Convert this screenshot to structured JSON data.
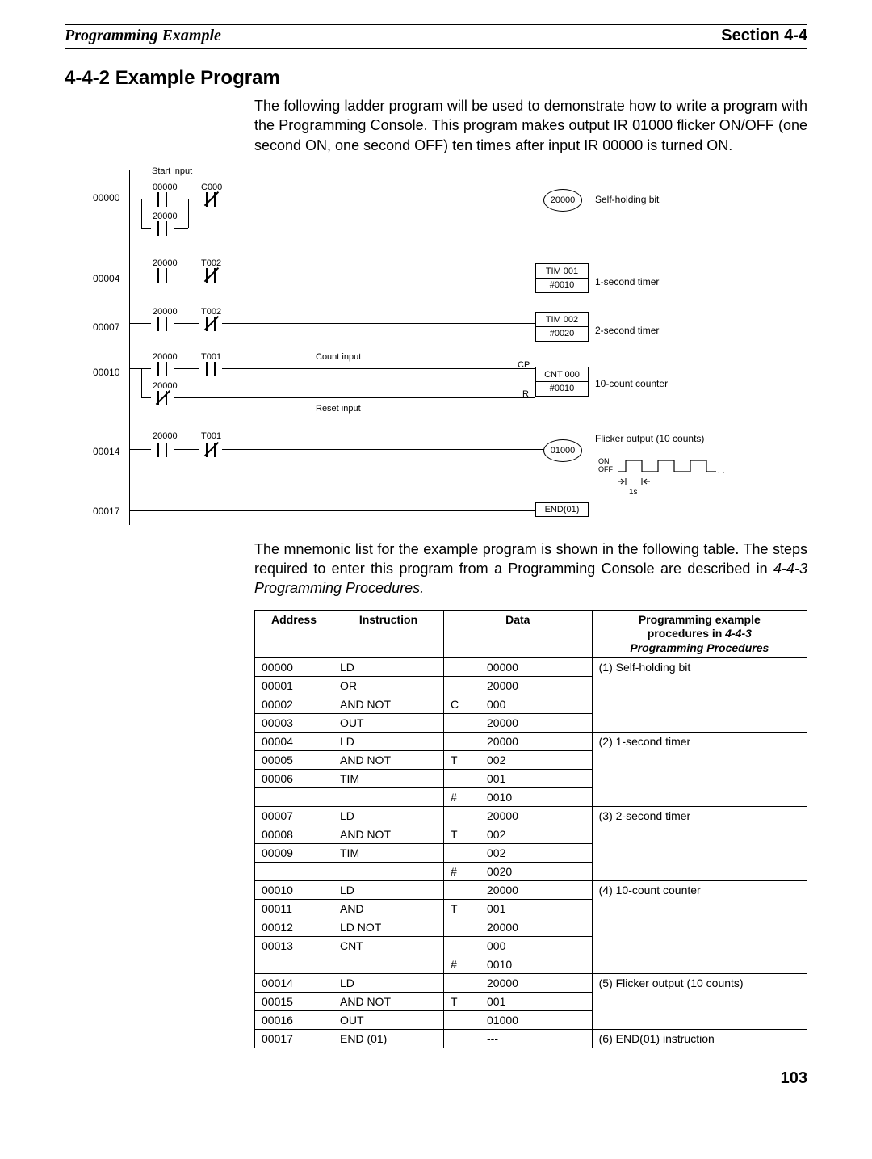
{
  "header": {
    "left": "Programming Example",
    "right": "Section 4-4"
  },
  "section_title": "4-4-2  Example Program",
  "intro": "The following ladder program will be used to demonstrate how to write a program with the Programming Console. This program makes output IR 01000 flicker ON/OFF (one second ON, one second OFF) ten times after input IR 00000 is turned ON.",
  "ladder": {
    "start_input": "Start input",
    "rungs": [
      {
        "addr": "00000",
        "c1": "00000",
        "c2": "C000",
        "or1": "20000",
        "coil": "20000",
        "ann": "Self-holding bit"
      },
      {
        "addr": "00004",
        "c1": "20000",
        "c2": "T002",
        "blk1": "TIM 001",
        "blk2": "#0010",
        "ann": "1-second timer"
      },
      {
        "addr": "00007",
        "c1": "20000",
        "c2": "T002",
        "blk1": "TIM 002",
        "blk2": "#0020",
        "ann": "2-second timer"
      },
      {
        "addr": "00010",
        "c1": "20000",
        "c2": "T001",
        "or1": "20000",
        "count_lbl": "Count input",
        "reset_lbl": "Reset input",
        "cp": "CP",
        "r": "R",
        "blk1": "CNT 000",
        "blk2": "#0010",
        "ann": "10-count counter"
      },
      {
        "addr": "00014",
        "c1": "20000",
        "c2": "T001",
        "coil": "01000",
        "ann": "Flicker output (10 counts)",
        "on": "ON",
        "off": "OFF",
        "one_s": "1s"
      },
      {
        "addr": "00017",
        "blk1": "END(01)"
      }
    ]
  },
  "mnemonic_para1": "The mnemonic list for the example program is shown in the following table. The steps required to enter this program from a Programming Console are described in ",
  "mnemonic_para_em": "4-4-3 Programming Procedures.",
  "table": {
    "headers": {
      "address": "Address",
      "instruction": "Instruction",
      "data": "Data",
      "proc1": "Programming example",
      "proc2": "procedures in ",
      "proc2em": "4-4-3",
      "proc3": "Programming Procedures"
    },
    "rows": [
      {
        "a": "00000",
        "i": "LD",
        "d1": "",
        "d2": "00000",
        "p": "(1) Self-holding bit",
        "prows": 4
      },
      {
        "a": "00001",
        "i": "OR",
        "d1": "",
        "d2": "20000"
      },
      {
        "a": "00002",
        "i": "AND NOT",
        "d1": "C",
        "d2": "000"
      },
      {
        "a": "00003",
        "i": "OUT",
        "d1": "",
        "d2": "20000"
      },
      {
        "a": "00004",
        "i": "LD",
        "d1": "",
        "d2": "20000",
        "p": "(2) 1-second timer",
        "prows": 4
      },
      {
        "a": "00005",
        "i": "AND NOT",
        "d1": "T",
        "d2": "002"
      },
      {
        "a": "00006",
        "i": "TIM",
        "d1": "",
        "d2": "001"
      },
      {
        "a": "",
        "i": "",
        "d1": "#",
        "d2": "0010"
      },
      {
        "a": "00007",
        "i": "LD",
        "d1": "",
        "d2": "20000",
        "p": "(3) 2-second timer",
        "prows": 4
      },
      {
        "a": "00008",
        "i": "AND NOT",
        "d1": "T",
        "d2": "002"
      },
      {
        "a": "00009",
        "i": "TIM",
        "d1": "",
        "d2": "002"
      },
      {
        "a": "",
        "i": "",
        "d1": "#",
        "d2": "0020"
      },
      {
        "a": "00010",
        "i": "LD",
        "d1": "",
        "d2": "20000",
        "p": "(4) 10-count counter",
        "prows": 5
      },
      {
        "a": "00011",
        "i": "AND",
        "d1": "T",
        "d2": "001"
      },
      {
        "a": "00012",
        "i": "LD NOT",
        "d1": "",
        "d2": "20000"
      },
      {
        "a": "00013",
        "i": "CNT",
        "d1": "",
        "d2": "000"
      },
      {
        "a": "",
        "i": "",
        "d1": "#",
        "d2": "0010"
      },
      {
        "a": "00014",
        "i": "LD",
        "d1": "",
        "d2": "20000",
        "p": "(5) Flicker output (10 counts)",
        "prows": 3
      },
      {
        "a": "00015",
        "i": "AND NOT",
        "d1": "T",
        "d2": "001"
      },
      {
        "a": "00016",
        "i": "OUT",
        "d1": "",
        "d2": "01000"
      },
      {
        "a": "00017",
        "i": "END (01)",
        "d1": "",
        "d2": "---",
        "p": "(6) END(01) instruction",
        "prows": 1
      }
    ]
  },
  "page_number": "103"
}
